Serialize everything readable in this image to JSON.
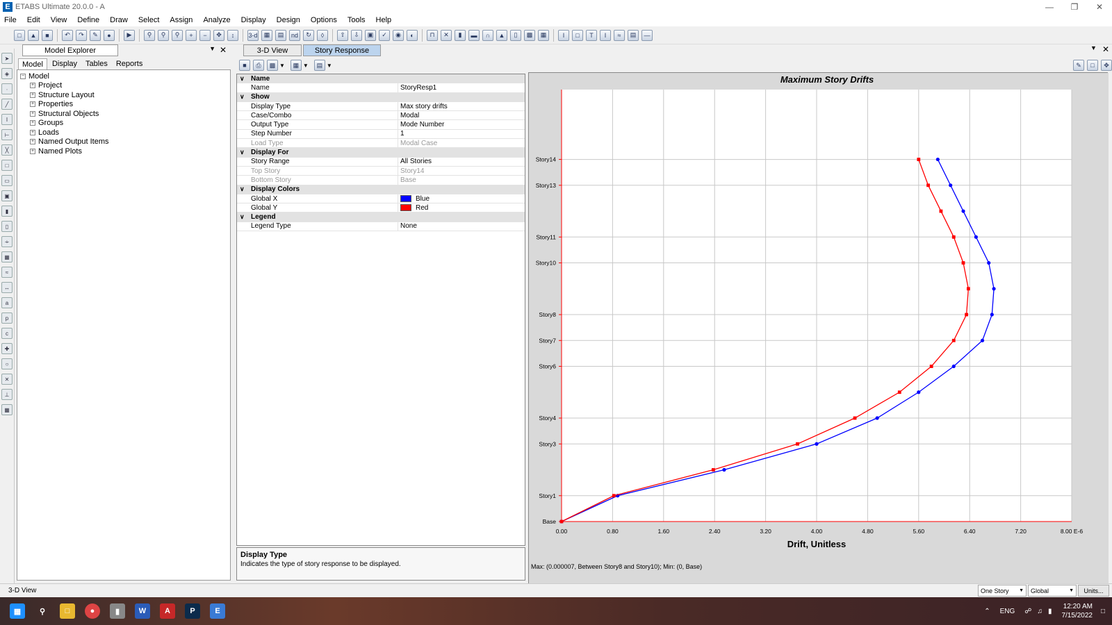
{
  "window": {
    "title": "ETABS Ultimate 20.0.0 - A",
    "icon_letter": "E"
  },
  "menu": [
    "File",
    "Edit",
    "View",
    "Define",
    "Draw",
    "Select",
    "Assign",
    "Analyze",
    "Display",
    "Design",
    "Options",
    "Tools",
    "Help"
  ],
  "toolbar": {
    "view_3d_label": "3-d",
    "plan_label": "nd"
  },
  "explorer": {
    "title": "Model Explorer",
    "tabs": [
      "Model",
      "Display",
      "Tables",
      "Reports"
    ],
    "root": "Model",
    "items": [
      "Project",
      "Structure Layout",
      "Properties",
      "Structural Objects",
      "Groups",
      "Loads",
      "Named Output Items",
      "Named Plots"
    ]
  },
  "doc_tabs": [
    "3-D View",
    "Story Response"
  ],
  "props": {
    "rows": [
      {
        "cat": true,
        "k": "Name"
      },
      {
        "k": "Name",
        "v": "StoryResp1"
      },
      {
        "cat": true,
        "k": "Show"
      },
      {
        "k": "Display Type",
        "v": "Max story drifts"
      },
      {
        "k": "Case/Combo",
        "v": "Modal"
      },
      {
        "k": "Output Type",
        "v": "Mode Number"
      },
      {
        "k": "Step Number",
        "v": "1"
      },
      {
        "k": "Load Type",
        "v": "Modal Case",
        "dis": true
      },
      {
        "cat": true,
        "k": "Display For"
      },
      {
        "k": "Story Range",
        "v": "All Stories"
      },
      {
        "k": "Top Story",
        "v": "Story14",
        "dis": true
      },
      {
        "k": "Bottom Story",
        "v": "Base",
        "dis": true
      },
      {
        "cat": true,
        "k": "Display Colors"
      },
      {
        "k": "Global X",
        "v": "Blue",
        "swatch": "#0000ff"
      },
      {
        "k": "Global Y",
        "v": "Red",
        "swatch": "#ff0000"
      },
      {
        "cat": true,
        "k": "Legend"
      },
      {
        "k": "Legend Type",
        "v": "None"
      }
    ],
    "help_title": "Display Type",
    "help_text": "Indicates the type of story response to be displayed."
  },
  "chart_data": {
    "type": "line",
    "title": "Maximum Story Drifts",
    "xlabel": "Drift, Unitless",
    "x_tick_labels": [
      "0.00",
      "0.80",
      "1.60",
      "2.40",
      "3.20",
      "4.00",
      "4.80",
      "5.60",
      "6.40",
      "7.20",
      "8.00 E-6"
    ],
    "xlim": [
      0,
      8
    ],
    "x_unit_note": "E-6",
    "stories": [
      {
        "name": "Base",
        "elev": 0
      },
      {
        "name": "Story1",
        "elev": 1
      },
      {
        "name": "Story3",
        "elev": 3
      },
      {
        "name": "Story4",
        "elev": 4
      },
      {
        "name": "Story6",
        "elev": 6
      },
      {
        "name": "Story7",
        "elev": 7
      },
      {
        "name": "Story8",
        "elev": 8
      },
      {
        "name": "Story10",
        "elev": 10
      },
      {
        "name": "Story11",
        "elev": 11
      },
      {
        "name": "Story13",
        "elev": 13
      },
      {
        "name": "Story14",
        "elev": 14
      }
    ],
    "ylim": [
      0,
      16.7
    ],
    "series": [
      {
        "color": "#0000ff",
        "points": [
          [
            0,
            0
          ],
          [
            0.88,
            1
          ],
          [
            2.55,
            2
          ],
          [
            4.0,
            3
          ],
          [
            4.95,
            4
          ],
          [
            5.6,
            5
          ],
          [
            6.15,
            6
          ],
          [
            6.6,
            7
          ],
          [
            6.75,
            8
          ],
          [
            6.78,
            9
          ],
          [
            6.7,
            10
          ],
          [
            6.5,
            11
          ],
          [
            6.3,
            12
          ],
          [
            6.1,
            13
          ],
          [
            5.9,
            14
          ]
        ]
      },
      {
        "color": "#ff0000",
        "points": [
          [
            0,
            0
          ],
          [
            0.82,
            1
          ],
          [
            2.38,
            2
          ],
          [
            3.7,
            3
          ],
          [
            4.6,
            4
          ],
          [
            5.3,
            5
          ],
          [
            5.8,
            6
          ],
          [
            6.15,
            7
          ],
          [
            6.35,
            8
          ],
          [
            6.38,
            9
          ],
          [
            6.3,
            10
          ],
          [
            6.15,
            11
          ],
          [
            5.95,
            12
          ],
          [
            5.75,
            13
          ],
          [
            5.6,
            14
          ]
        ]
      }
    ],
    "grid": true,
    "footer": "Max: (0.000007, Between Story8 and Story10);   Min: (0, Base)"
  },
  "status": {
    "left": "3-D View",
    "story_mode": "One Story",
    "coord_sys": "Global",
    "units_button": "Units..."
  },
  "taskbar": {
    "lang": "ENG",
    "time": "12:20 AM",
    "date": "7/15/2022"
  }
}
